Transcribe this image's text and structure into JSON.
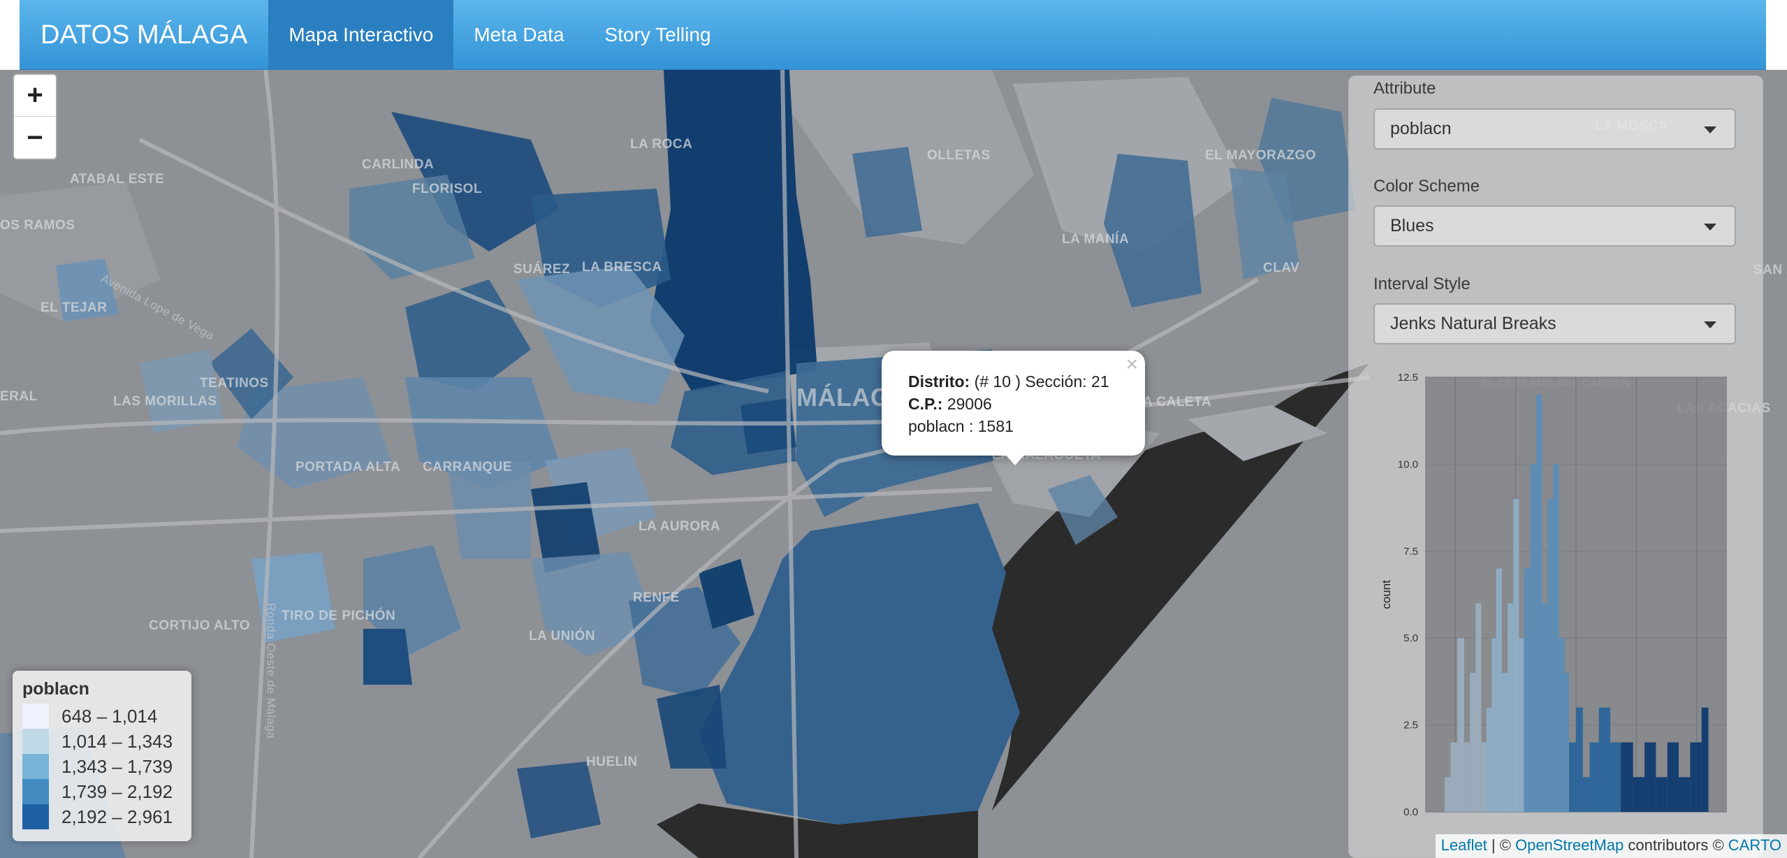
{
  "nav": {
    "brand": "DATOS MÁLAGA",
    "tabs": [
      {
        "label": "Mapa Interactivo",
        "active": true
      },
      {
        "label": "Meta Data",
        "active": false
      },
      {
        "label": "Story Telling",
        "active": false
      }
    ]
  },
  "map": {
    "zoom_in": "+",
    "zoom_out": "−",
    "labels": {
      "la_roca": "LA ROCA",
      "olletas": "OLLETAS",
      "el_mayorazgo": "EL MAYORAZGO",
      "carlinda": "CARLINDA",
      "florisol": "FLORISOL",
      "atabal_este": "ATABAL ESTE",
      "os_ramos": "OS RAMOS",
      "la_mania": "LA MANÍA",
      "suarez": "SUÁREZ",
      "la_bresca": "LA BRESCA",
      "clav": "CLAV",
      "el_tejar": "EL TEJAR",
      "teatinos": "TEATINOS",
      "las_morillas": "LAS MORILLAS",
      "eral": "ERAL",
      "malaga": "MÁLAGA",
      "la_caleta": "LA CALETA",
      "la_malagueta": "LA MALAGUETA",
      "portada_alta": "PORTADA ALTA",
      "carranque": "CARRANQUE",
      "la_aurora": "LA AURORA",
      "renfe": "RENFE",
      "cortijo_alto": "CORTIJO ALTO",
      "tiro_de_pichon": "TIRO DE PICHÓN",
      "la_union": "LA UNIÓN",
      "huelin": "HUELIN",
      "la_mosca": "LA MOSCA",
      "el_cerrado": "EL CERRADO DEL CARMEN",
      "las_acacias": "LAS ACACIAS",
      "lope_de_vega": "Avenida Lope de Vega",
      "ronda_oeste": "Ronda Oeste de Málaga",
      "san_an": "SAN AN"
    }
  },
  "popup": {
    "close": "×",
    "distrito_label": "Distrito:",
    "distrito_value": "(# 10 ) Sección: 21",
    "cp_label": "C.P.:",
    "cp_value": "29006",
    "attr_line": "poblacn : 1581"
  },
  "legend": {
    "title": "poblacn",
    "items": [
      {
        "label": "648 – 1,014",
        "color": "#eff3ff"
      },
      {
        "label": "1,014 – 1,343",
        "color": "#bdd7e7"
      },
      {
        "label": "1,343 – 1,739",
        "color": "#6baed6"
      },
      {
        "label": "1,739 – 2,192",
        "color": "#3182bd"
      },
      {
        "label": "2,192 – 2,961",
        "color": "#08519c"
      }
    ]
  },
  "controls": {
    "attribute_label": "Attribute",
    "attribute_value": "poblacn",
    "scheme_label": "Color Scheme",
    "scheme_value": "Blues",
    "interval_label": "Interval Style",
    "interval_value": "Jenks Natural Breaks"
  },
  "chart_data": {
    "type": "bar",
    "xlabel": "",
    "ylabel": "count",
    "ylim": [
      0,
      12.5
    ],
    "yticks": [
      "0.0",
      "2.5",
      "5.0",
      "7.5",
      "10.0",
      "12.5"
    ],
    "values": [
      1,
      2,
      3,
      5,
      8,
      4,
      6,
      5,
      9,
      7,
      12,
      6,
      9,
      5,
      8,
      7,
      10,
      6,
      5,
      3,
      2,
      1,
      2,
      2,
      1,
      3,
      2,
      3
    ],
    "bins": [
      {
        "start": 648,
        "count": 1,
        "class": 1
      },
      {
        "start": 700,
        "count": 2,
        "class": 1
      },
      {
        "start": 760,
        "count": 5,
        "class": 1
      },
      {
        "start": 820,
        "count": 2,
        "class": 1
      },
      {
        "start": 870,
        "count": 4,
        "class": 1
      },
      {
        "start": 920,
        "count": 6,
        "class": 1
      },
      {
        "start": 970,
        "count": 2,
        "class": 1
      },
      {
        "start": 1014,
        "count": 3,
        "class": 2
      },
      {
        "start": 1060,
        "count": 5,
        "class": 2
      },
      {
        "start": 1100,
        "count": 7,
        "class": 2
      },
      {
        "start": 1150,
        "count": 4,
        "class": 2
      },
      {
        "start": 1200,
        "count": 6,
        "class": 2
      },
      {
        "start": 1250,
        "count": 9,
        "class": 2
      },
      {
        "start": 1300,
        "count": 5,
        "class": 2
      },
      {
        "start": 1343,
        "count": 7,
        "class": 3
      },
      {
        "start": 1400,
        "count": 10,
        "class": 3
      },
      {
        "start": 1450,
        "count": 12,
        "class": 3
      },
      {
        "start": 1500,
        "count": 6,
        "class": 3
      },
      {
        "start": 1550,
        "count": 9,
        "class": 3
      },
      {
        "start": 1600,
        "count": 10,
        "class": 3
      },
      {
        "start": 1650,
        "count": 5,
        "class": 3
      },
      {
        "start": 1700,
        "count": 4,
        "class": 3
      },
      {
        "start": 1739,
        "count": 2,
        "class": 4
      },
      {
        "start": 1800,
        "count": 3,
        "class": 4
      },
      {
        "start": 1860,
        "count": 1,
        "class": 4
      },
      {
        "start": 1920,
        "count": 2,
        "class": 4
      },
      {
        "start": 2000,
        "count": 3,
        "class": 4
      },
      {
        "start": 2100,
        "count": 2,
        "class": 4
      },
      {
        "start": 2192,
        "count": 2,
        "class": 5
      },
      {
        "start": 2300,
        "count": 1,
        "class": 5
      },
      {
        "start": 2400,
        "count": 2,
        "class": 5
      },
      {
        "start": 2500,
        "count": 1,
        "class": 5
      },
      {
        "start": 2600,
        "count": 2,
        "class": 5
      },
      {
        "start": 2700,
        "count": 1,
        "class": 5
      },
      {
        "start": 2800,
        "count": 2,
        "class": 5
      },
      {
        "start": 2900,
        "count": 3,
        "class": 5
      }
    ]
  },
  "attribution": {
    "leaflet": "Leaflet",
    "sep1": " | © ",
    "osm": "OpenStreetMap",
    "contributors": " contributors © ",
    "carto": "CARTO"
  }
}
